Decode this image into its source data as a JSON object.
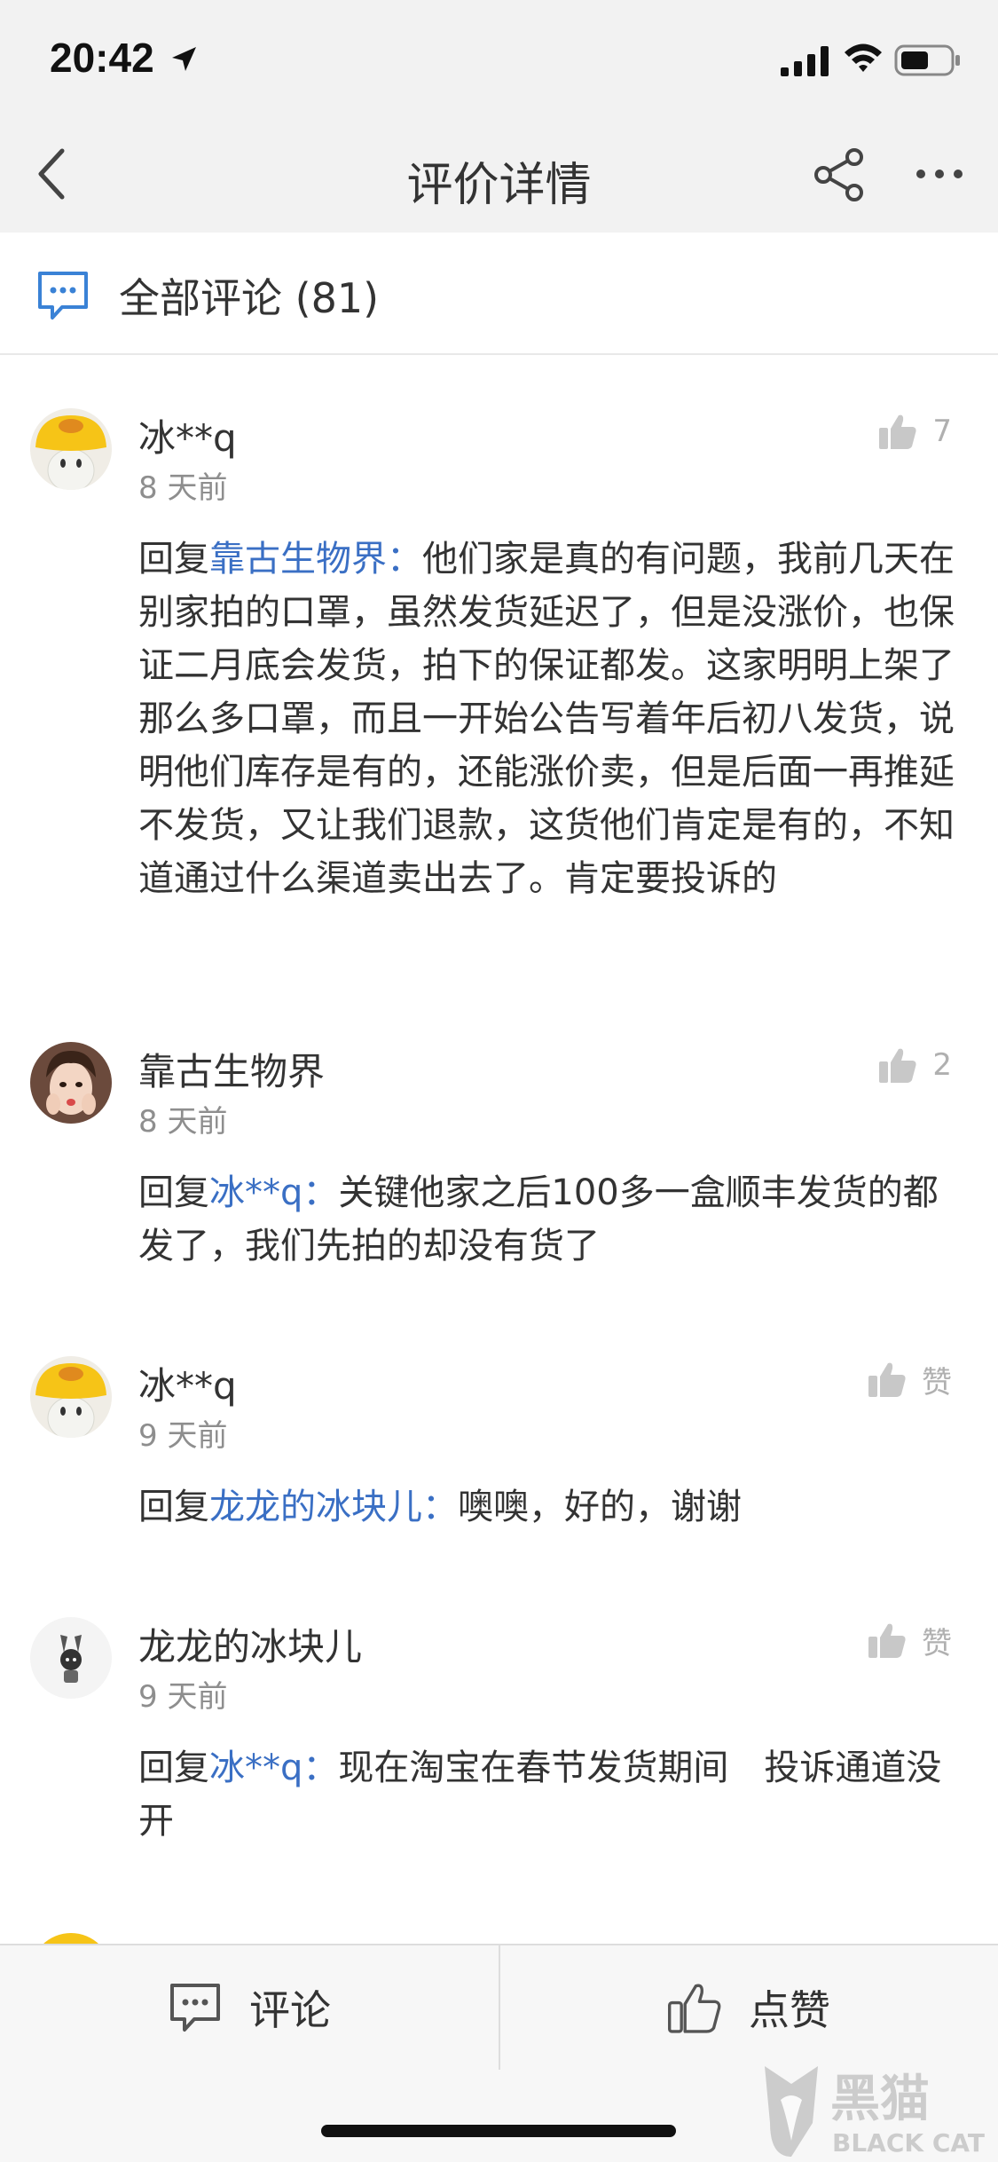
{
  "status_bar": {
    "time": "20:42"
  },
  "nav": {
    "title": "评价详情"
  },
  "section": {
    "title": "全部评论 (81)"
  },
  "comments": [
    {
      "name": "冰**q",
      "time": "8 天前",
      "likes": "7",
      "reply_prefix": "回复",
      "reply_target": "靠古生物界：",
      "text": "他们家是真的有问题，我前几天在别家拍的口罩，虽然发货延迟了，但是没涨价，也保证二月底会发货，拍下的保证都发。这家明明上架了那么多口罩，而且一开始公告写着年后初八发货，说明他们库存是有的，还能涨价卖，但是后面一再推延不发货，又让我们退款，这货他们肯定是有的，不知道通过什么渠道卖出去了。肯定要投诉的"
    },
    {
      "name": "靠古生物界",
      "time": "8 天前",
      "likes": "2",
      "reply_prefix": "回复",
      "reply_target": "冰**q：",
      "text": "关键他家之后100多一盒顺丰发货的都发了，我们先拍的却没有货了"
    },
    {
      "name": "冰**q",
      "time": "9 天前",
      "likes": "赞",
      "reply_prefix": "回复",
      "reply_target": "龙龙的冰块儿：",
      "text": "噢噢，好的，谢谢"
    },
    {
      "name": "龙龙的冰块儿",
      "time": "9 天前",
      "likes": "赞",
      "reply_prefix": "回复",
      "reply_target": "冰**q：",
      "text": "现在淘宝在春节发货期间　投诉通道没开"
    }
  ],
  "bottom_bar": {
    "comment_label": "评论",
    "like_label": "点赞"
  },
  "colors": {
    "link": "#3a6fc4",
    "accent_icon": "#3a82d6",
    "like_icon": "#c8c8c8"
  },
  "watermark": {
    "text_cn": "黑猫",
    "text_en": "BLACK CAT"
  }
}
